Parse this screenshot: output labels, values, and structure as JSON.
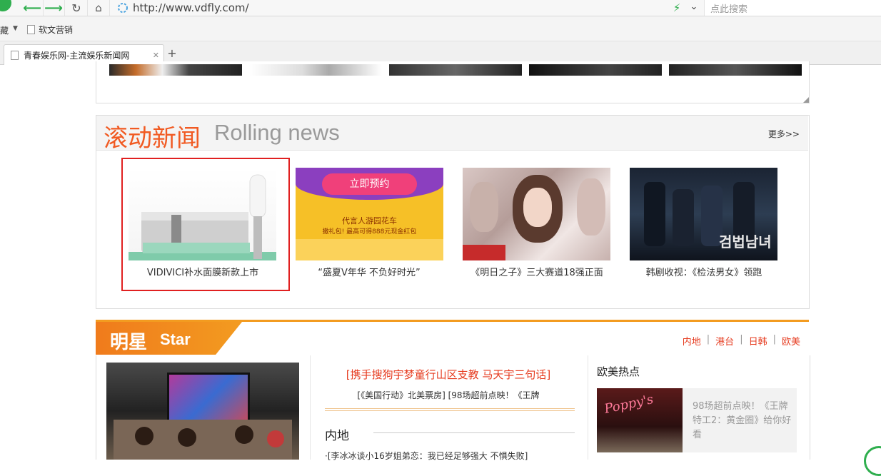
{
  "browser": {
    "url": "http://www.vdfly.com/",
    "search_placeholder": "点此搜索",
    "bookmarks": {
      "left_fragment": "藏",
      "item_label": "软文营销"
    },
    "tab": {
      "title": "青春娱乐网-主流娱乐新闻网",
      "close_glyph": "✕",
      "new_tab_glyph": "+"
    }
  },
  "rolling_news": {
    "title_cn": "滚动新闻",
    "title_en": "Rolling news",
    "more_label": "更多>>",
    "items": [
      {
        "caption": "VIDIVICI补水面膜新款上市",
        "image": "cosmetic-jar-with-brush"
      },
      {
        "caption": "“盛夏V年华 不负好时光”",
        "image": "promo-banner-pink-purple"
      },
      {
        "caption": "《明日之子》三大赛道18强正面",
        "image": "tv-show-still"
      },
      {
        "caption": "韩剧收视：《检法男女》领跑",
        "image": "korean-drama-poster"
      }
    ],
    "promo_banner": {
      "button_text": "立即预约",
      "line1": "代言人游园花车",
      "line2": "撒礼包! 最高可得888元现金红包"
    },
    "drama_title_glyphs": "검법남녀"
  },
  "star_section": {
    "title_cn": "明星",
    "title_en": "Star",
    "categories": [
      "内地",
      "港台",
      "日韩",
      "欧美"
    ],
    "headline": "[携手搜狗宇梦童行山区支教 马天宇三句话]",
    "sublinks": "[《美国行动》北美票房]  [98场超前点映！《王牌",
    "mainland_label": "内地",
    "list_item": "·[李冰冰谈小16岁姐弟恋：我已经足够强大 不惧失败]",
    "western_title": "欧美热点",
    "western_item_text": "98场超前点映！《王牌特工2：黄金圈》给你好看",
    "western_sign": "Poppy's"
  },
  "colors": {
    "accent_orange": "#f15a22",
    "star_orange": "#f39b20",
    "link_red": "#e63b1f",
    "highlight_box": "#e02020",
    "green_icon": "#2fae4e"
  }
}
